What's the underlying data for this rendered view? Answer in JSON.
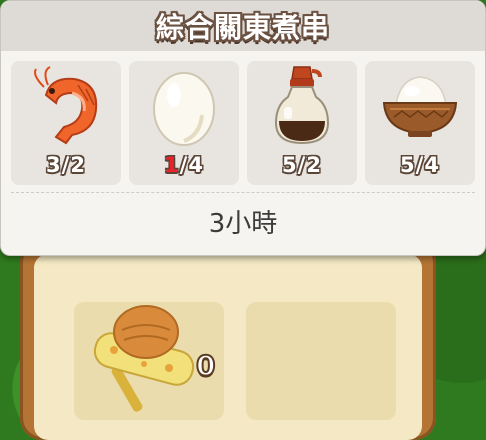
{
  "recipe": {
    "title": "綜合關東煮串",
    "time": "3小時",
    "ingredients": [
      {
        "icon": "shrimp-icon",
        "have": "3",
        "need": "2",
        "enough": true
      },
      {
        "icon": "egg-icon",
        "have": "1",
        "need": "4",
        "enough": false
      },
      {
        "icon": "soy-sauce-icon",
        "have": "5",
        "need": "2",
        "enough": true
      },
      {
        "icon": "rice-bowl-icon",
        "have": "5",
        "need": "4",
        "enough": true
      }
    ]
  },
  "background": {
    "slot_count": "0"
  },
  "colors": {
    "shortage": "#e8232e",
    "text_outline": "#5b4537",
    "popup_bg": "#f6f4f1"
  }
}
